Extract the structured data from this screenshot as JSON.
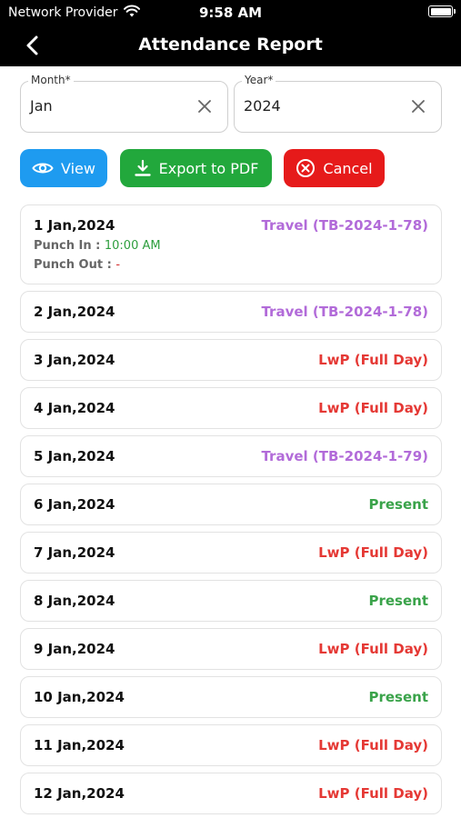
{
  "status_bar": {
    "carrier": "Network Provider",
    "time": "9:58 AM"
  },
  "header": {
    "title": "Attendance Report"
  },
  "filters": {
    "month": {
      "label": "Month*",
      "value": "Jan"
    },
    "year": {
      "label": "Year*",
      "value": "2024"
    }
  },
  "actions": {
    "view": "View",
    "export": "Export to PDF",
    "cancel": "Cancel"
  },
  "colors": {
    "travel": "#b26bd9",
    "lwp": "#e53935",
    "present": "#3aa34a",
    "view": "#1e9bf0",
    "export": "#22a83c",
    "cancel": "#e61a1a"
  },
  "records": [
    {
      "date": "1 Jan,2024",
      "status": "Travel (TB-2024-1-78)",
      "kind": "travel",
      "punch_in_label": "Punch In :",
      "punch_in": "10:00 AM",
      "punch_out_label": "Punch Out :",
      "punch_out": "-"
    },
    {
      "date": "2 Jan,2024",
      "status": "Travel (TB-2024-1-78)",
      "kind": "travel"
    },
    {
      "date": "3 Jan,2024",
      "status": "LwP (Full Day)",
      "kind": "lwp"
    },
    {
      "date": "4 Jan,2024",
      "status": "LwP (Full Day)",
      "kind": "lwp"
    },
    {
      "date": "5 Jan,2024",
      "status": "Travel (TB-2024-1-79)",
      "kind": "travel"
    },
    {
      "date": "6 Jan,2024",
      "status": "Present",
      "kind": "present"
    },
    {
      "date": "7 Jan,2024",
      "status": "LwP (Full Day)",
      "kind": "lwp"
    },
    {
      "date": "8 Jan,2024",
      "status": "Present",
      "kind": "present"
    },
    {
      "date": "9 Jan,2024",
      "status": "LwP (Full Day)",
      "kind": "lwp"
    },
    {
      "date": "10 Jan,2024",
      "status": "Present",
      "kind": "present"
    },
    {
      "date": "11 Jan,2024",
      "status": "LwP (Full Day)",
      "kind": "lwp"
    },
    {
      "date": "12 Jan,2024",
      "status": "LwP (Full Day)",
      "kind": "lwp"
    }
  ]
}
